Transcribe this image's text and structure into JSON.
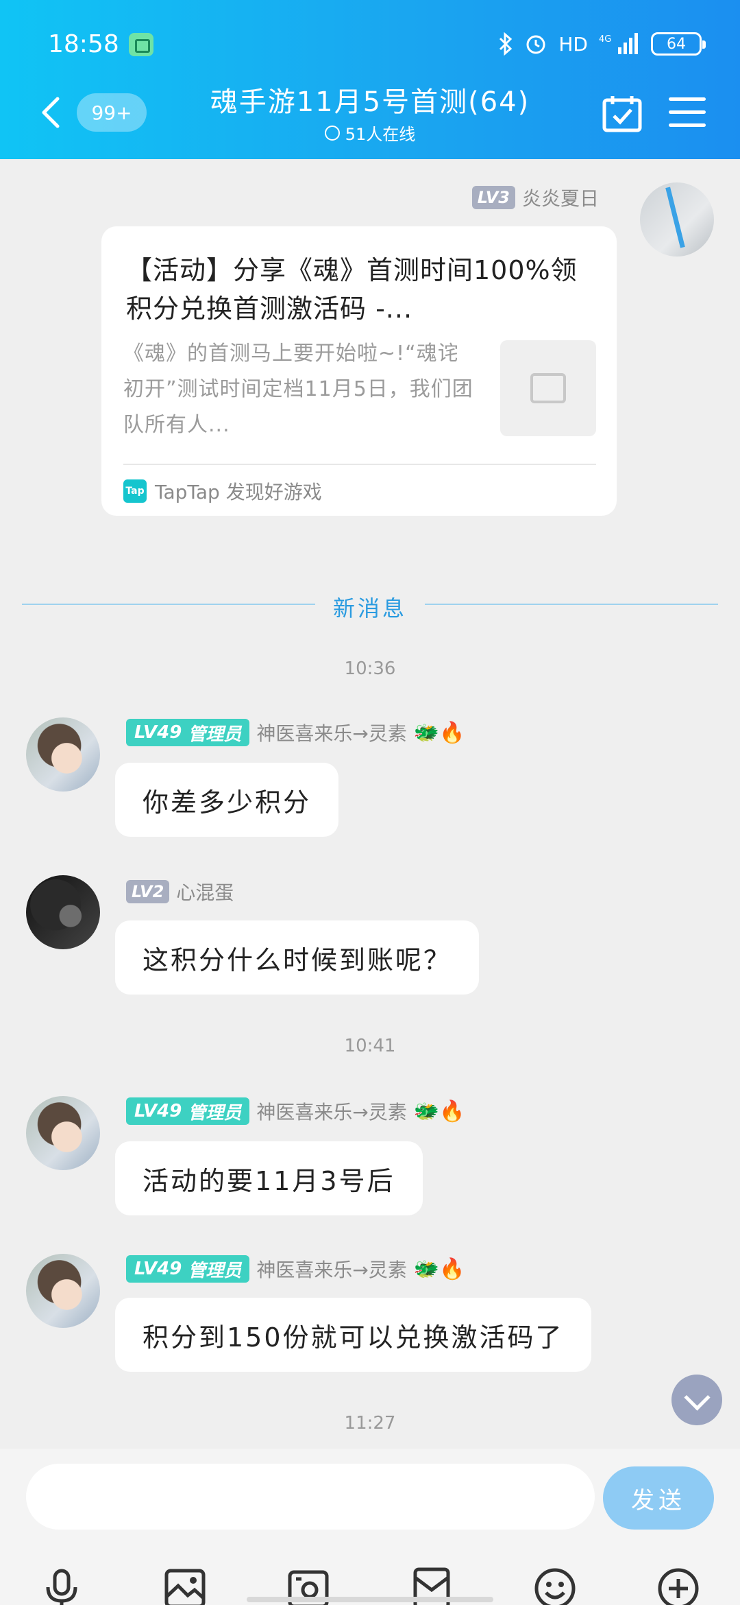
{
  "status_bar": {
    "time": "18:58",
    "network": "HD",
    "signal_label": "4G",
    "battery": "64"
  },
  "header": {
    "back_badge": "99+",
    "title": "魂手游11月5号首测(64)",
    "online": "51人在线"
  },
  "shared_card": {
    "sender_level": "LV3",
    "sender_name": "炎炎夏日",
    "title": "【活动】分享《魂》首测时间100%领积分兑换首测激活码 -...",
    "description": "《魂》的首测马上要开始啦~!“魂诧初开”测试时间定档11月5日，我们团队所有人...",
    "source": "TapTap 发现好游戏",
    "source_logo_text": "Tap"
  },
  "divider": {
    "new_messages": "新消息"
  },
  "messages": [
    {
      "time": "10:36"
    },
    {
      "level": "LV49",
      "role": "管理员",
      "name": "神医喜来乐→灵素",
      "emojis": "🐲🔥",
      "text": "你差多少积分"
    },
    {
      "level": "LV2",
      "name": "心混蛋",
      "text": "这积分什么时候到账呢？"
    },
    {
      "time": "10:41"
    },
    {
      "level": "LV49",
      "role": "管理员",
      "name": "神医喜来乐→灵素",
      "emojis": "🐲🔥",
      "text": "活动的要11月3号后"
    },
    {
      "level": "LV49",
      "role": "管理员",
      "name": "神医喜来乐→灵素",
      "emojis": "🐲🔥",
      "text": "积分到150份就可以兑换激活码了"
    },
    {
      "time": "11:27"
    }
  ],
  "input": {
    "send_label": "发送"
  },
  "toolbar_icons": [
    "microphone-icon",
    "image-icon",
    "camera-icon",
    "red-packet-icon",
    "emoji-icon",
    "plus-icon"
  ],
  "colors": {
    "header_start": "#10c4f5",
    "header_end": "#1b8ff0",
    "admin_badge": "#3dd1c2",
    "send_button": "#8ecbf4"
  }
}
